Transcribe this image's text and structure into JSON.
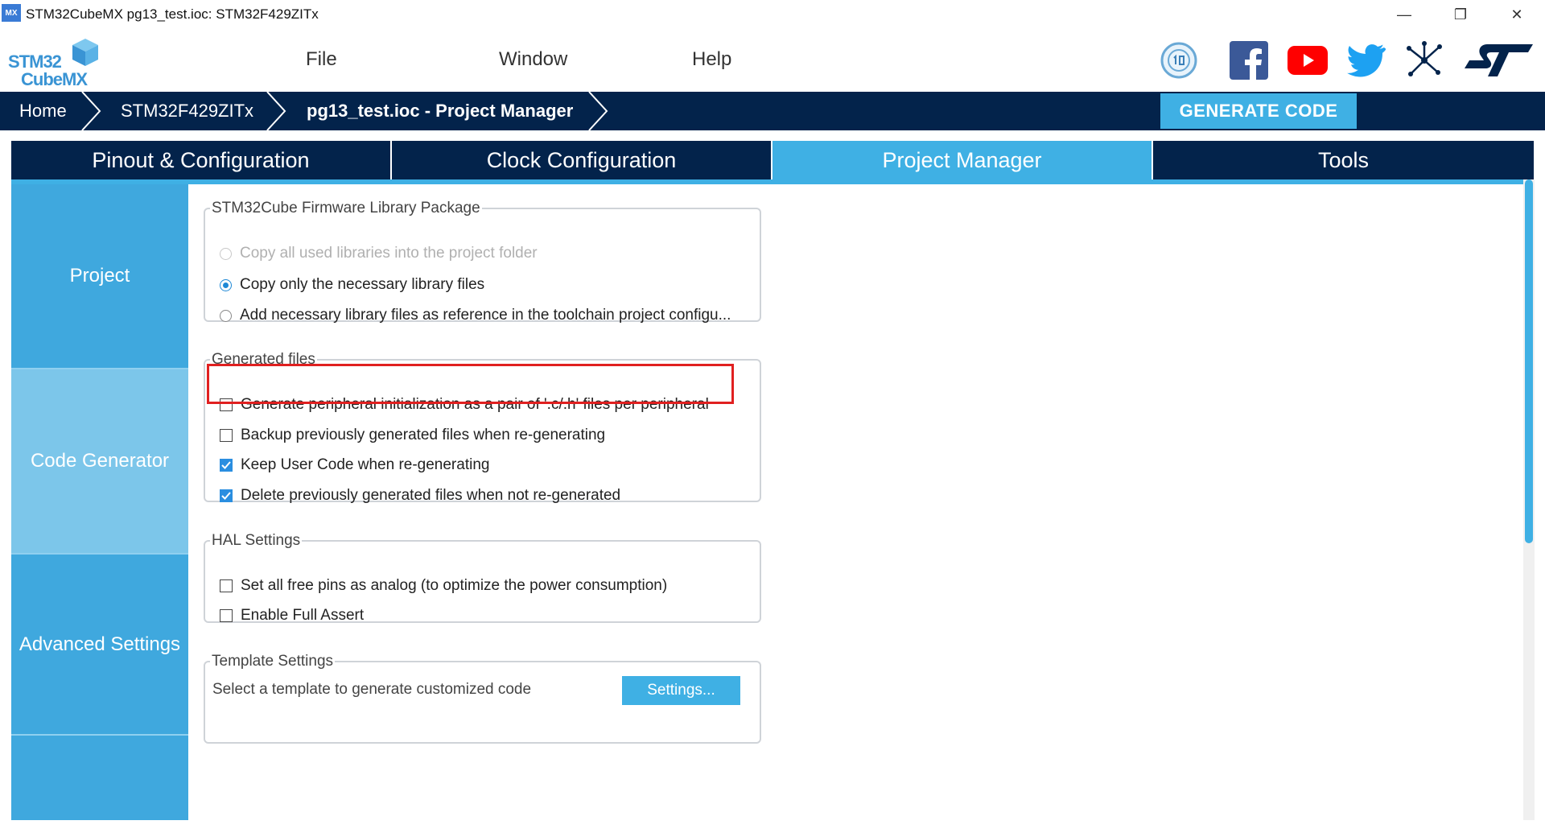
{
  "window": {
    "app_icon": "MX",
    "title": "STM32CubeMX pg13_test.ioc: STM32F429ZITx",
    "minimize_glyph": "—",
    "restore_glyph": "❐",
    "close_glyph": "✕"
  },
  "logo": {
    "line1": "STM32",
    "line2": "CubeMX"
  },
  "menu": {
    "file": "File",
    "window": "Window",
    "help": "Help"
  },
  "breadcrumb": {
    "home": "Home",
    "device": "STM32F429ZITx",
    "project": "pg13_test.ioc - Project Manager",
    "generate_label": "GENERATE CODE"
  },
  "tabs": [
    {
      "label": "Pinout & Configuration"
    },
    {
      "label": "Clock Configuration"
    },
    {
      "label": "Project Manager"
    },
    {
      "label": "Tools"
    }
  ],
  "active_tab": "Project Manager",
  "sidenav": [
    {
      "label": "Project"
    },
    {
      "label": "Code Generator"
    },
    {
      "label": "Advanced Settings"
    }
  ],
  "active_side": "Code Generator",
  "firmware": {
    "legend": "STM32Cube Firmware Library Package",
    "options": [
      {
        "label": "Copy all used libraries into the project folder",
        "checked": false,
        "disabled": true
      },
      {
        "label": "Copy only the necessary library files",
        "checked": true,
        "disabled": false
      },
      {
        "label": "Add necessary library files as reference in the toolchain project configu...",
        "checked": false,
        "disabled": false
      }
    ]
  },
  "generated": {
    "legend": "Generated files",
    "options": [
      {
        "label": "Generate peripheral initialization as a pair of '.c/.h' files per peripheral",
        "checked": false
      },
      {
        "label": "Backup previously generated files when re-generating",
        "checked": false
      },
      {
        "label": "Keep User Code when re-generating",
        "checked": true
      },
      {
        "label": "Delete previously generated files when not re-generated",
        "checked": true
      }
    ]
  },
  "hal": {
    "legend": "HAL Settings",
    "options": [
      {
        "label": "Set all free pins as analog (to optimize the power consumption)",
        "checked": false
      },
      {
        "label": "Enable Full Assert",
        "checked": false
      }
    ]
  },
  "template": {
    "legend": "Template Settings",
    "text": "Select a template to generate customized code",
    "button": "Settings..."
  },
  "colors": {
    "dark_navy": "#03234b",
    "accent_blue": "#3fb0e4",
    "highlight_red": "#e02020"
  },
  "icons": [
    "anniversary-badge-icon",
    "facebook-icon",
    "youtube-icon",
    "twitter-icon",
    "network-icon",
    "st-logo-icon"
  ]
}
